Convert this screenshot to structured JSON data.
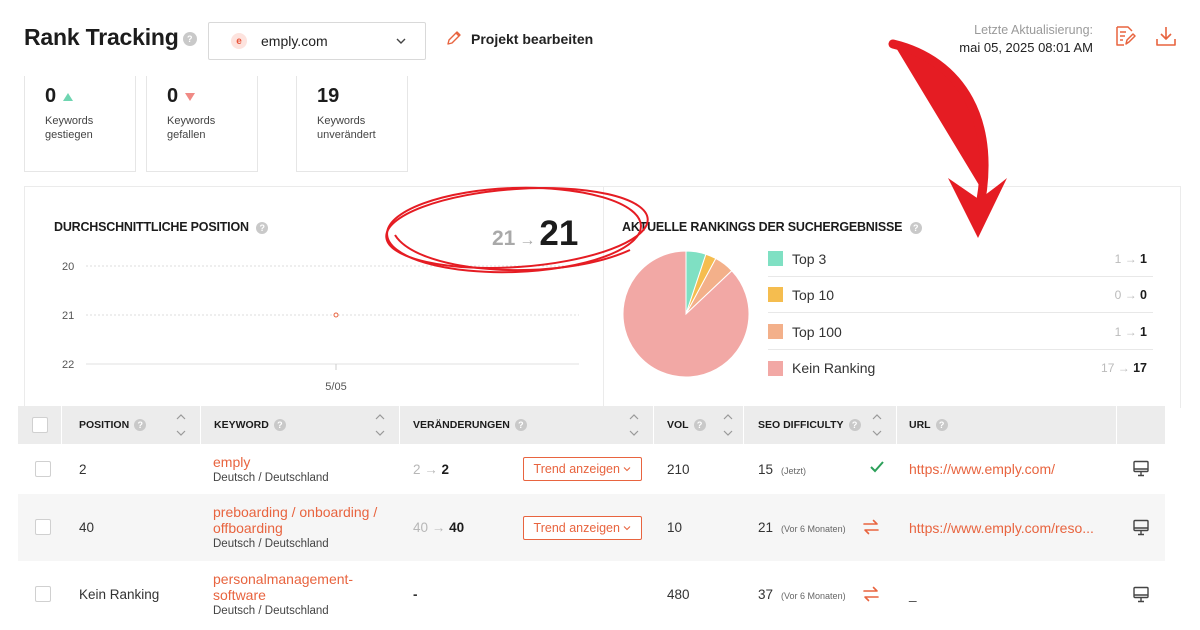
{
  "header": {
    "title": "Rank Tracking",
    "domain_initial": "e",
    "domain": "emply.com",
    "edit_label": "Projekt bearbeiten",
    "update_label": "Letzte Aktualisierung:",
    "update_time": "mai 05, 2025 08:01 AM"
  },
  "stats": [
    {
      "value": "0",
      "label": "Keywords gestiegen",
      "trend": "up"
    },
    {
      "value": "0",
      "label": "Keywords gefallen",
      "trend": "down"
    },
    {
      "value": "19",
      "label": "Keywords unverändert",
      "trend": "none"
    }
  ],
  "avg_position": {
    "title": "DURCHSCHNITTLICHE POSITION",
    "from": "21",
    "to": "21",
    "arrow": "→",
    "y_ticks": [
      "20",
      "21",
      "22"
    ],
    "x_ticks": [
      "5/05"
    ]
  },
  "chart_data": [
    {
      "type": "line",
      "x": [
        "5/05"
      ],
      "y": [
        21
      ],
      "ylim": [
        20,
        22
      ],
      "y_inverted": true,
      "grid": true
    },
    {
      "type": "pie",
      "title": "AKTUELLE RANKINGS DER SUCHERGEBNISSE",
      "categories": [
        "Top 3",
        "Top 10",
        "Top 100",
        "Kein Ranking"
      ],
      "values": [
        1,
        0,
        1,
        17
      ],
      "colors": [
        "#7fe0c3",
        "#f5bd4f",
        "#f3b08a",
        "#f2a8a5"
      ]
    }
  ],
  "rankings": {
    "title": "AKTUELLE RANKINGS DER SUCHERGEBNISSE",
    "arrow": "→",
    "items": [
      {
        "label": "Top 3",
        "from": "1",
        "to": "1"
      },
      {
        "label": "Top 10",
        "from": "0",
        "to": "0"
      },
      {
        "label": "Top 100",
        "from": "1",
        "to": "1"
      },
      {
        "label": "Kein Ranking",
        "from": "17",
        "to": "17"
      }
    ]
  },
  "table": {
    "headers": {
      "position": "POSITION",
      "keyword": "KEYWORD",
      "changes": "VERÄNDERUNGEN",
      "vol": "VOL",
      "seo": "SEO DIFFICULTY",
      "url": "URL"
    },
    "trend_label": "Trend anzeigen",
    "rows": [
      {
        "position": "2",
        "keyword": "emply",
        "location": "Deutsch / Deutschland",
        "change_from": "2",
        "change_to": "2",
        "vol": "210",
        "seo": "15",
        "seo_note": "(Jetzt)",
        "url": "https://www.emply.com/"
      },
      {
        "position": "40",
        "keyword": "preboarding / onboarding / offboarding",
        "location": "Deutsch / Deutschland",
        "change_from": "40",
        "change_to": "40",
        "vol": "10",
        "seo": "21",
        "seo_note": "(Vor 6 Monaten)",
        "url": "https://www.emply.com/reso..."
      },
      {
        "position": "Kein Ranking",
        "keyword": "personalmanagement-software",
        "location": "Deutsch / Deutschland",
        "change_none": "-",
        "vol": "480",
        "seo": "37",
        "seo_note": "(Vor 6 Monaten)",
        "url": "_"
      }
    ]
  }
}
